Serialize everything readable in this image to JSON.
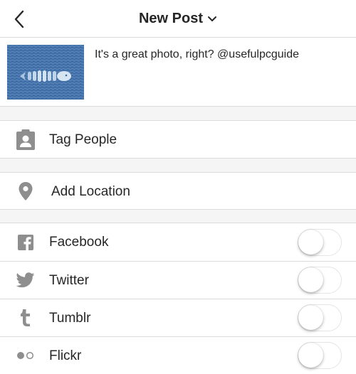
{
  "header": {
    "title": "New Post",
    "back_icon": "chevron-left-icon",
    "dropdown_icon": "chevron-down-icon"
  },
  "post": {
    "caption": "It's a great photo, right? @usefulpcguide"
  },
  "rows": {
    "tag_people": {
      "label": "Tag People",
      "icon": "tag-person-icon"
    },
    "add_location": {
      "label": "Add Location",
      "icon": "location-pin-icon"
    }
  },
  "share": [
    {
      "label": "Facebook",
      "icon": "facebook-icon",
      "enabled": false
    },
    {
      "label": "Twitter",
      "icon": "twitter-icon",
      "enabled": false
    },
    {
      "label": "Tumblr",
      "icon": "tumblr-icon",
      "enabled": false
    },
    {
      "label": "Flickr",
      "icon": "flickr-icon",
      "enabled": false
    }
  ],
  "colors": {
    "text": "#262626",
    "icon_gray": "#8e8e8e",
    "separator": "#dbdbdb",
    "section_gap": "#f5f5f5"
  }
}
